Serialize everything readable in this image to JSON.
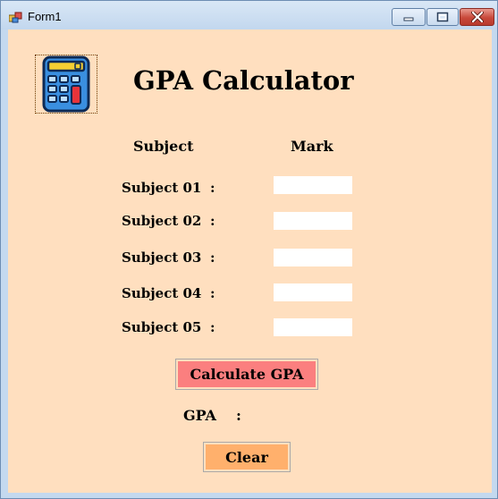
{
  "window": {
    "title": "Form1",
    "accent": "#b9d1ea",
    "client_bg": "#ffdfbf"
  },
  "titlebar_buttons": [
    "minimize-icon",
    "maximize-icon",
    "close-icon"
  ],
  "logo": {
    "icon": "calculator-icon"
  },
  "heading": "GPA Calculator",
  "columns": {
    "subject": "Subject",
    "mark": "Mark"
  },
  "subjects": [
    {
      "label": "Subject 01",
      "colon": ":",
      "mark": ""
    },
    {
      "label": "Subject 02",
      "colon": ":",
      "mark": ""
    },
    {
      "label": "Subject 03",
      "colon": ":",
      "mark": ""
    },
    {
      "label": "Subject 04",
      "colon": ":",
      "mark": ""
    },
    {
      "label": "Subject 05",
      "colon": ":",
      "mark": ""
    }
  ],
  "buttons": {
    "calculate": {
      "label": "Calculate GPA",
      "color": "#fb7f7f"
    },
    "clear": {
      "label": "Clear",
      "color": "#ffb06c"
    }
  },
  "result": {
    "label": "GPA",
    "colon": ":",
    "value": ""
  }
}
